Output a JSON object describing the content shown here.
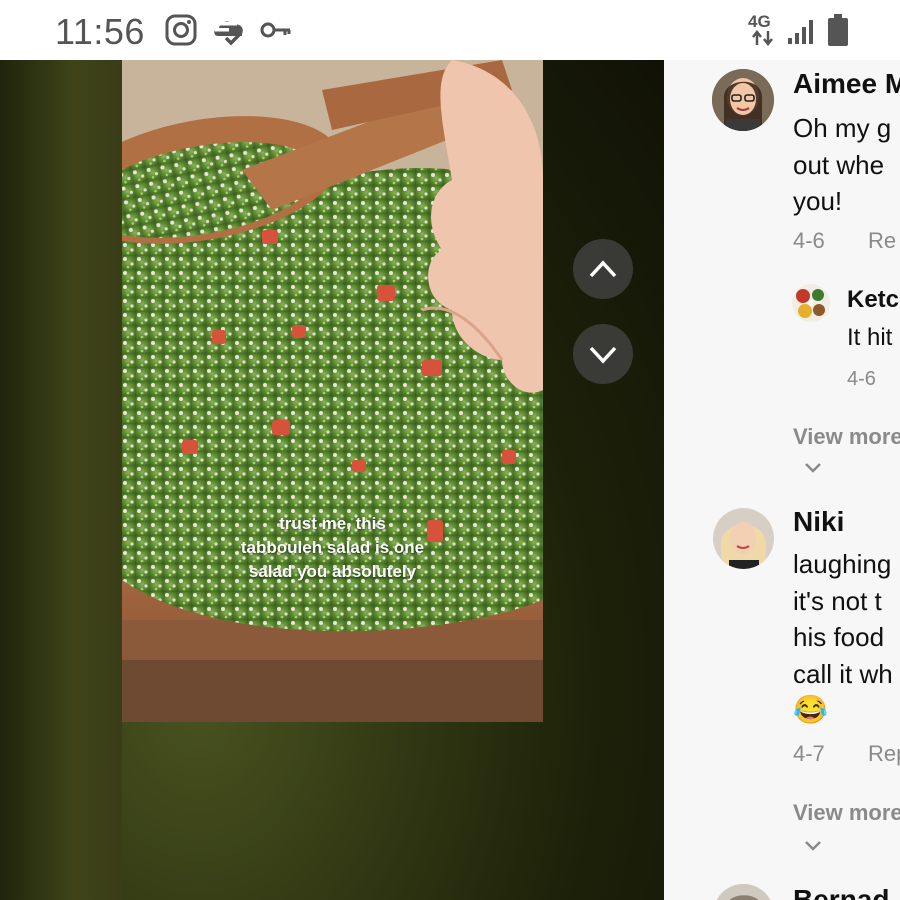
{
  "status_bar": {
    "time": "11:56",
    "network_label": "4G",
    "icons": [
      "instagram-icon",
      "cloud-check-icon",
      "key-icon",
      "data-arrows-icon",
      "signal-icon",
      "battery-icon"
    ]
  },
  "video": {
    "caption_lines": [
      "trust me, this",
      "tabbouleh salad is one",
      "salad you absolutely"
    ],
    "nav": {
      "up_icon": "chevron-up-icon",
      "down_icon": "chevron-down-icon"
    }
  },
  "comments": [
    {
      "author": "Aimee M",
      "lines": [
        "Oh my g",
        "out whe",
        "you!"
      ],
      "date": "4-6",
      "reply_label": "Re",
      "replies": [
        {
          "author": "Ketc",
          "lines": [
            "It hit"
          ],
          "date": "4-6"
        }
      ],
      "view_more": "View more"
    },
    {
      "author": "Niki",
      "lines": [
        "laughing",
        "it's not t",
        "his food",
        "call it wh",
        "😂"
      ],
      "date": "4-7",
      "reply_label": "Rep",
      "view_more": "View more"
    },
    {
      "author": "Bernad"
    }
  ],
  "colors": {
    "status_bg": "#ffffff",
    "panel_bg": "#f7f7f7",
    "meta_gray": "#8a8a8a",
    "text_dark": "#111111"
  }
}
